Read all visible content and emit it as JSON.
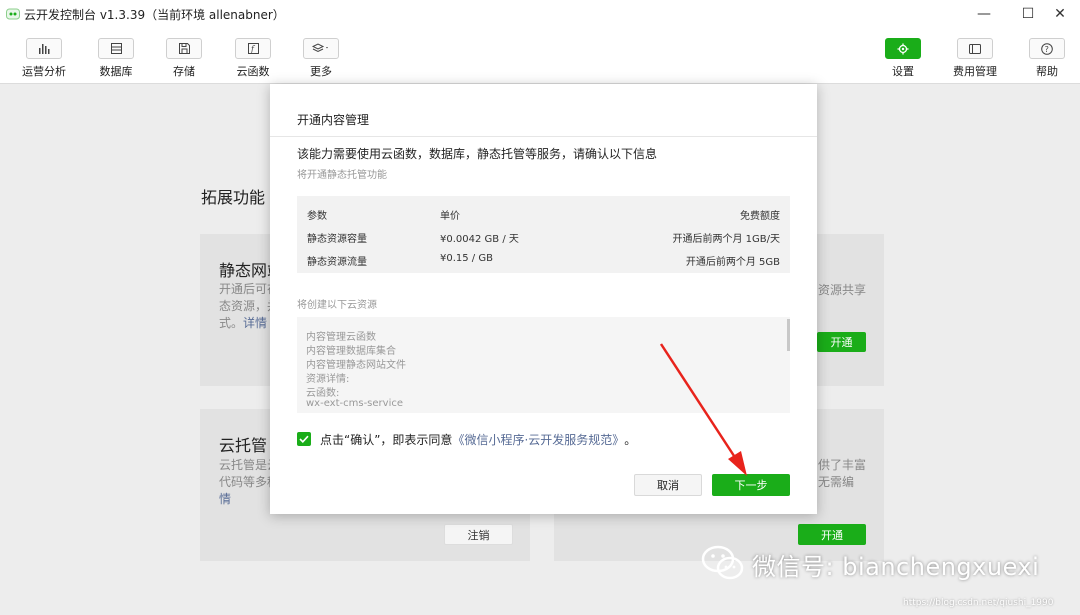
{
  "window": {
    "title": "云开发控制台 v1.3.39（当前环境 allenabner）",
    "minimize": "—",
    "maximize": "☐",
    "close": "✕"
  },
  "toolbar": {
    "left": [
      {
        "label": "运营分析",
        "icon": "bar-chart-icon"
      },
      {
        "label": "数据库",
        "icon": "database-icon"
      },
      {
        "label": "存储",
        "icon": "save-icon"
      },
      {
        "label": "云函数",
        "icon": "function-icon"
      },
      {
        "label": "更多",
        "icon": "layers-icon"
      }
    ],
    "right": [
      {
        "label": "设置",
        "icon": "gear-icon",
        "active": true
      },
      {
        "label": "费用管理",
        "icon": "billing-icon"
      },
      {
        "label": "帮助",
        "icon": "help-icon"
      }
    ]
  },
  "background": {
    "heading": "拓展功能",
    "card1": {
      "title": "静态网站",
      "text_lines": [
        "开通后可在",
        "态资源，并",
        "式。"
      ],
      "link": "详情",
      "right_text": "资源共享",
      "button": "开通"
    },
    "card2": {
      "title": "云托管",
      "text_lines": [
        "云托管是云",
        "代码等多种"
      ],
      "link": "情",
      "right_text_lines": [
        "供了丰富",
        "无需编"
      ],
      "cancel_button": "注销",
      "button": "开通"
    }
  },
  "modal": {
    "title": "开通内容管理",
    "description": "该能力需要使用云函数，数据库，静态托管等服务，请确认以下信息",
    "subtitle": "将开通静态托管功能",
    "pricing": {
      "headers": [
        "参数",
        "单价",
        "免费额度"
      ],
      "rows": [
        [
          "静态资源容量",
          "¥0.0042 GB / 天",
          "开通后前两个月 1GB/天"
        ],
        [
          "静态资源流量",
          "¥0.15 / GB",
          "开通后前两个月 5GB"
        ]
      ]
    },
    "resources_label": "将创建以下云资源",
    "resources": [
      "内容管理云函数",
      "内容管理数据库集合",
      "内容管理静态网站文件",
      "资源详情:",
      "云函数:",
      "wx-ext-cms-service"
    ],
    "agreement_prefix": "点击“确认”，即表示同意",
    "agreement_link": "《微信小程序·云开发服务规范》",
    "agreement_suffix": "。",
    "cancel_label": "取消",
    "next_label": "下一步"
  },
  "watermark": {
    "text": "微信号: bianchengxuexi",
    "url": "https://blog.csdn.net/qiushi_1990"
  },
  "colors": {
    "brand_green": "#1aad19",
    "link_blue": "#576b95",
    "arrow_red": "#e8231c"
  }
}
